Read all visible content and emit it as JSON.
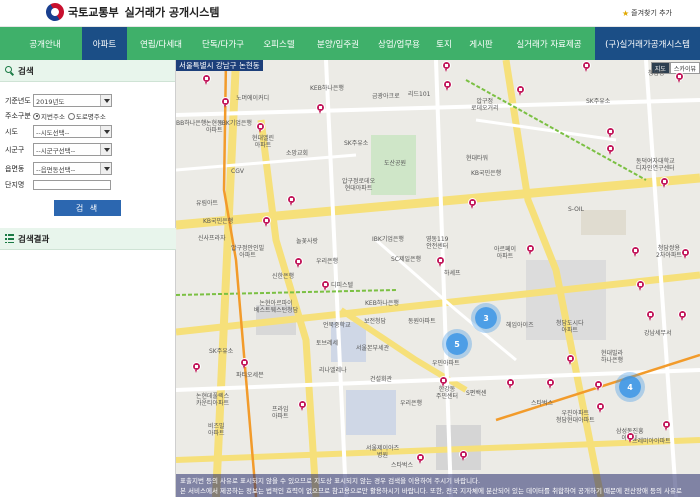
{
  "header": {
    "ministry": "국토교통부",
    "system": "실거래가 공개시스템",
    "favorite": "즐겨찾기 추가"
  },
  "nav": [
    {
      "label": "공개안내",
      "active": false
    },
    {
      "label": "아파트",
      "active": true
    },
    {
      "label": "연립/다세대",
      "active": false
    },
    {
      "label": "단독/다가구",
      "active": false
    },
    {
      "label": "오피스텔",
      "active": false
    },
    {
      "label": "분양/입주권",
      "active": false
    },
    {
      "label": "상업/업무용",
      "active": false
    },
    {
      "label": "토지",
      "active": false
    },
    {
      "label": "게시판",
      "active": false
    },
    {
      "label": "실거래가 자료제공",
      "active": false
    },
    {
      "label": "(구)실거래가공개시스템",
      "active": false
    }
  ],
  "sidebar": {
    "search_title": "검색",
    "year_label": "기준년도",
    "year_value": "2019년도",
    "address_type_label": "주소구분",
    "address_type_jibun": "지번주소",
    "address_type_road": "도로명주소",
    "sido_label": "시도",
    "sido_value": "--시도선택--",
    "sigungu_label": "시군구",
    "sigungu_value": "--시군구선택--",
    "dong_label": "읍면동",
    "dong_value": "--읍면동선택--",
    "complex_label": "단지명",
    "search_button": "검 색",
    "results_title": "검색결과"
  },
  "map": {
    "address_bar": "서울특별시 강남구 논현동",
    "map_type_normal": "지도",
    "map_type_sky": "스카이뷰",
    "clusters": [
      "3",
      "5",
      "4"
    ],
    "notice_line1": "표출지번 등의 사유로 표시되지 않을 수 있으므로 지도상 표시되지 않는 경우 검색을 이용하여 주시기 바랍니다.",
    "notice_line2": "본 서비스에서 제공하는 정보는 법적인 효력이 없으므로 참고용으로만 활용하시기 바랍니다. 또한, 전국 지자체에 분산되어 있는 데이터를 취합하여 공개하기 때문에 전산장애 등의 사유로"
  },
  "colors": {
    "nav_bg": "#3fb06a",
    "nav_active": "#1b4e86",
    "pin": "#c2185b",
    "cluster": "#3c96e6"
  }
}
